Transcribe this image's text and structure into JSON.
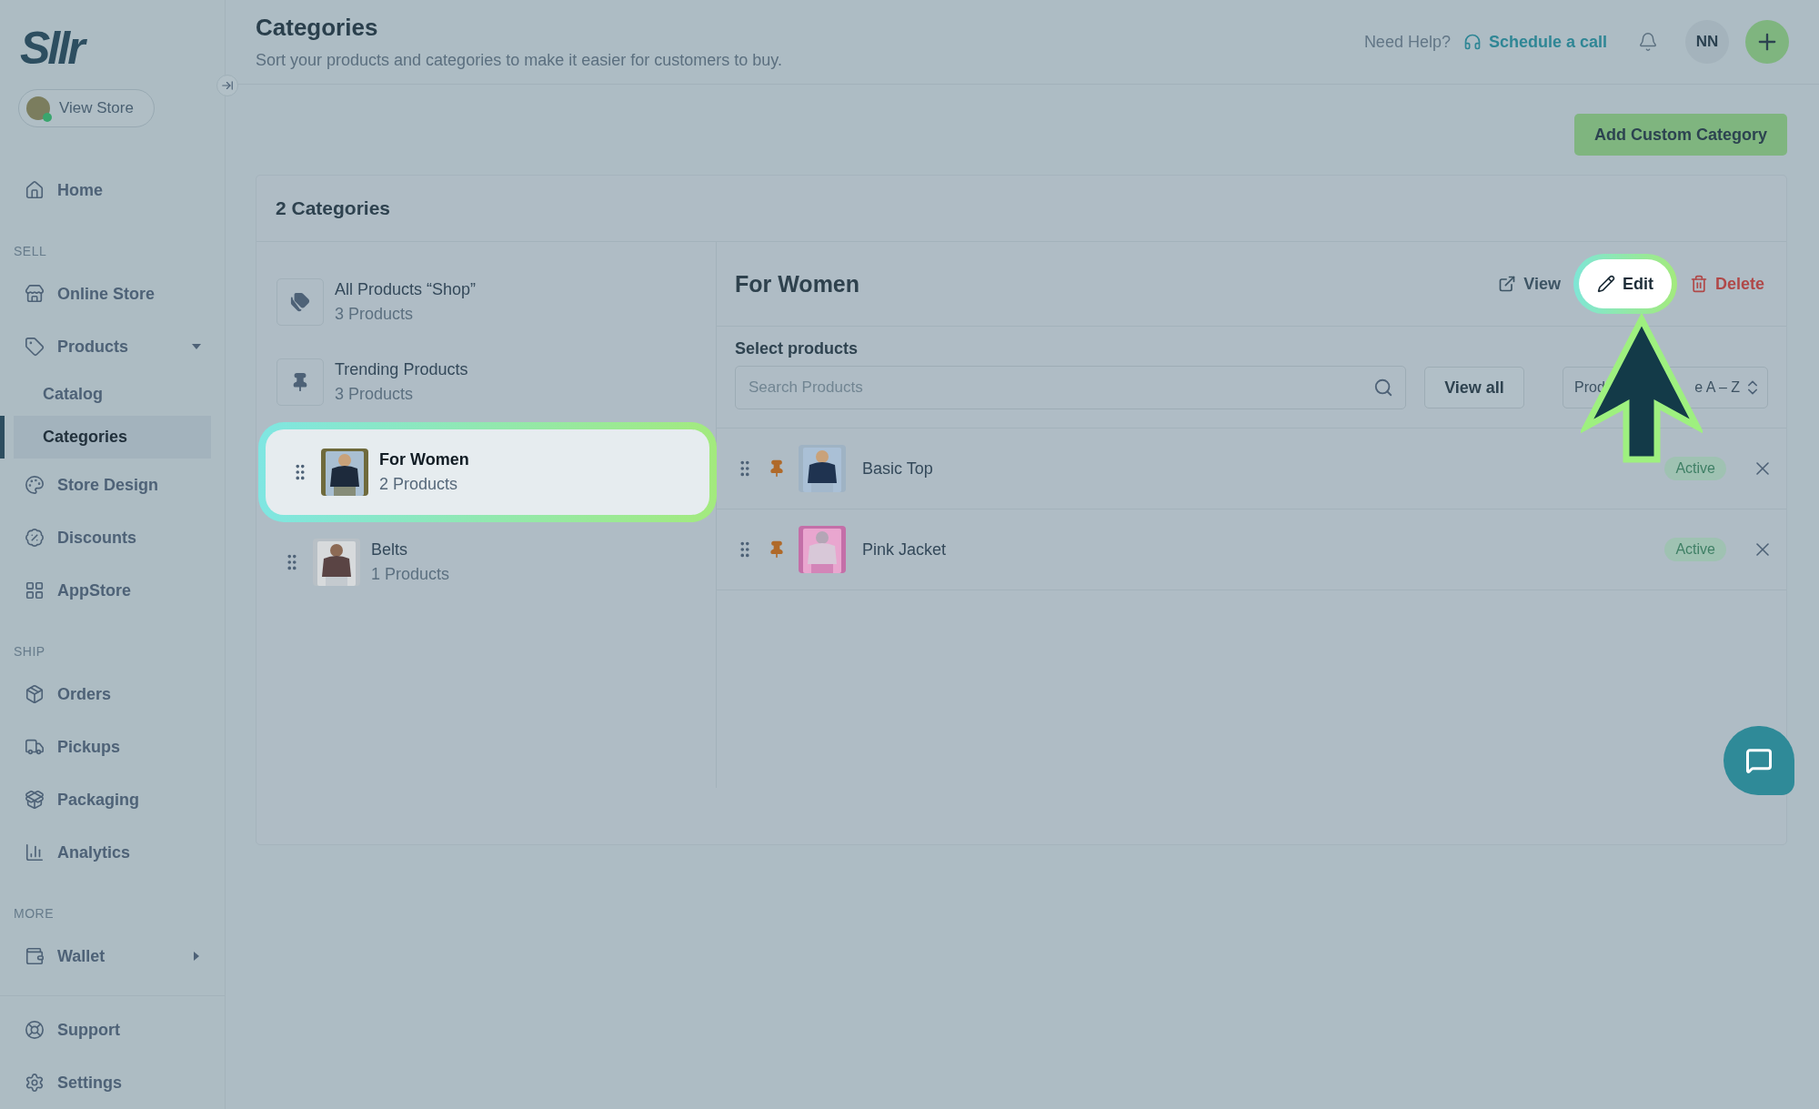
{
  "sidebar": {
    "logo": "Sllr",
    "view_store": "View Store",
    "groups": [
      {
        "items": [
          {
            "label": "Home",
            "selected": false
          }
        ]
      },
      {
        "label": "SELL",
        "items": [
          {
            "label": "Online Store",
            "selected": false
          },
          {
            "label": "Products",
            "selected": false,
            "expanded": true,
            "children": [
              {
                "label": "Catalog",
                "selected": false
              },
              {
                "label": "Categories",
                "selected": true
              }
            ]
          },
          {
            "label": "Store Design",
            "selected": false
          },
          {
            "label": "Discounts",
            "selected": false
          },
          {
            "label": "AppStore",
            "selected": false
          }
        ]
      },
      {
        "label": "SHIP",
        "items": [
          {
            "label": "Orders",
            "selected": false
          },
          {
            "label": "Pickups",
            "selected": false
          },
          {
            "label": "Packaging",
            "selected": false
          },
          {
            "label": "Analytics",
            "selected": false
          }
        ]
      },
      {
        "label": "MORE",
        "items": [
          {
            "label": "Wallet",
            "selected": false,
            "expanded": false
          }
        ]
      }
    ],
    "bottom": [
      {
        "label": "Support",
        "selected": false
      },
      {
        "label": "Settings",
        "selected": false
      }
    ]
  },
  "header": {
    "title": "Categories",
    "subtitle": "Sort your products and categories to make it easier for customers to buy.",
    "help_text": "Need Help?",
    "help_link": "Schedule a call",
    "avatar": "NN"
  },
  "add_button": "Add Custom Category",
  "card": {
    "count": "2 Categories",
    "categories": [
      {
        "name": "All Products “Shop”",
        "count": "3 Products",
        "kind": "system",
        "selected": false
      },
      {
        "name": "Trending Products",
        "count": "3 Products",
        "kind": "pinned",
        "selected": false
      },
      {
        "name": "For Women",
        "count": "2 Products",
        "kind": "custom",
        "selected": true
      },
      {
        "name": "Belts",
        "count": "1 Products",
        "kind": "custom",
        "selected": false
      }
    ],
    "detail": {
      "title": "For Women",
      "actions": [
        {
          "label": "View",
          "kind": "view",
          "spotlight": false
        },
        {
          "label": "Edit",
          "kind": "edit",
          "spotlight": true
        },
        {
          "label": "Delete",
          "kind": "delete",
          "spotlight": false
        }
      ],
      "select_label": "Select products",
      "search": {
        "placeholder": "Search Products"
      },
      "view_all": "View all",
      "sort": {
        "start": "Prod",
        "end": "e A – Z"
      },
      "products": [
        {
          "name": "Basic Top",
          "status": "Active",
          "pinned": true
        },
        {
          "name": "Pink Jacket",
          "status": "Active",
          "pinned": true
        }
      ]
    }
  }
}
